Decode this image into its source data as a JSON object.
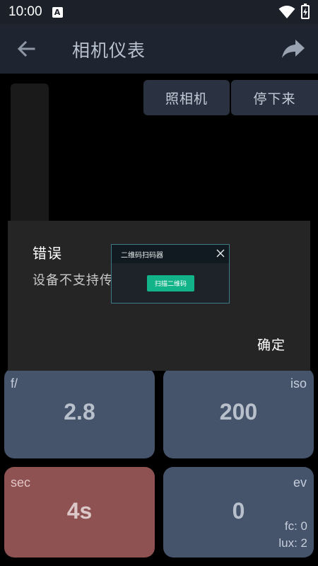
{
  "status_bar": {
    "time": "10:00",
    "notification_letter": "A"
  },
  "app_bar": {
    "title": "相机仪表"
  },
  "camera_controls": {
    "take_photo_label": "照相机",
    "stop_label": "停下来"
  },
  "error_dialog": {
    "title": "错误",
    "message": "设备不支持传",
    "ok_label": "确定"
  },
  "qr_popup": {
    "title": "二维码扫码器",
    "scan_button_label": "扫描二维码",
    "accent_color": "#13b38a"
  },
  "meters": {
    "aperture": {
      "label": "f/",
      "value": "2.8"
    },
    "iso": {
      "label": "iso",
      "value": "200"
    },
    "shutter": {
      "label": "sec",
      "value": "4s",
      "color": "#8f5252"
    },
    "ev": {
      "label": "ev",
      "value": "0",
      "fc": "fc: 0",
      "lux": "lux: 2"
    }
  },
  "colors": {
    "tile_blue": "#45536b",
    "app_bar": "#1e2430",
    "dialog_bg": "#252525"
  },
  "icons": {
    "back": "arrow-left-icon",
    "share": "share-arrow-icon",
    "wifi": "wifi-icon",
    "battery": "battery-icon",
    "close": "close-icon"
  }
}
